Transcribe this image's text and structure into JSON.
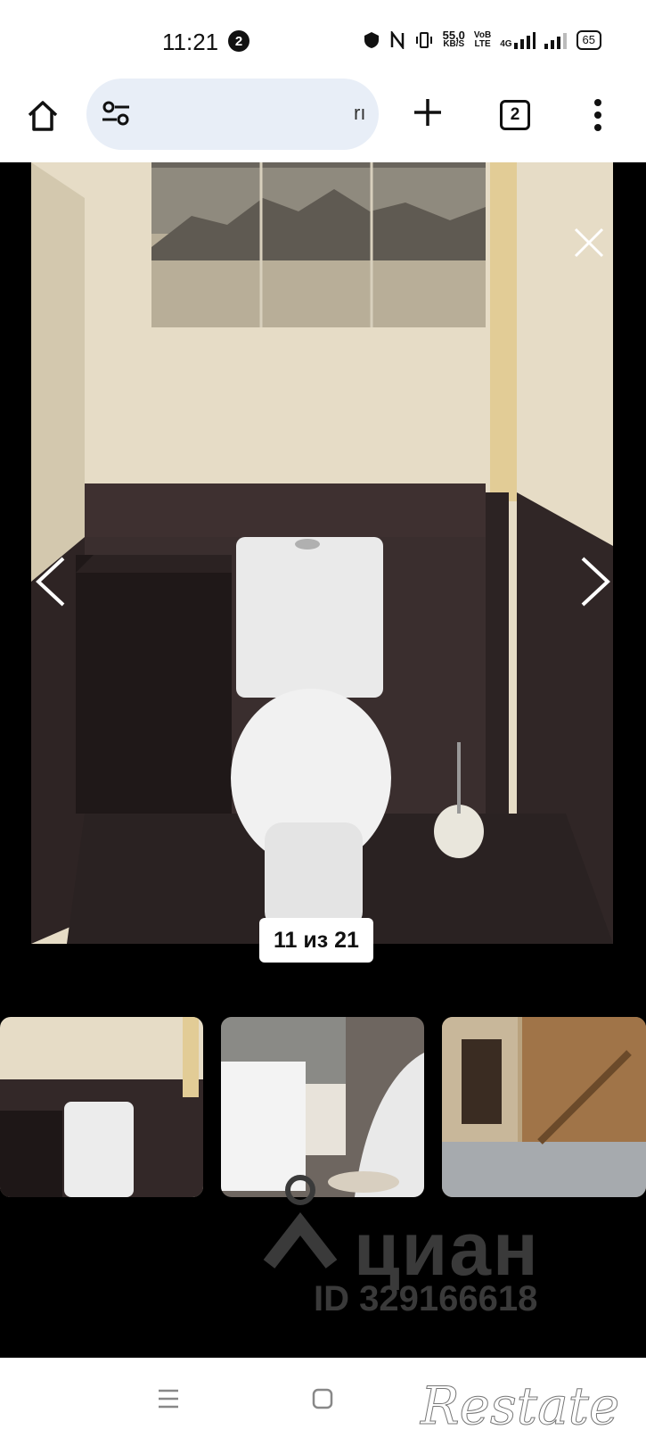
{
  "status_bar": {
    "time": "11:21",
    "notification_count": "2",
    "speed_value": "55,0",
    "speed_unit": "KB/S",
    "volte_top": "VoB",
    "volte_bottom": "LTE",
    "network": "4G",
    "battery": "65"
  },
  "toolbar": {
    "url_fragment": "rı",
    "tab_count": "2"
  },
  "viewer": {
    "counter": "11 из 21"
  },
  "watermark": {
    "brand": "циан",
    "id": "ID 329166618"
  },
  "navbar": {
    "brand": "Restate"
  }
}
